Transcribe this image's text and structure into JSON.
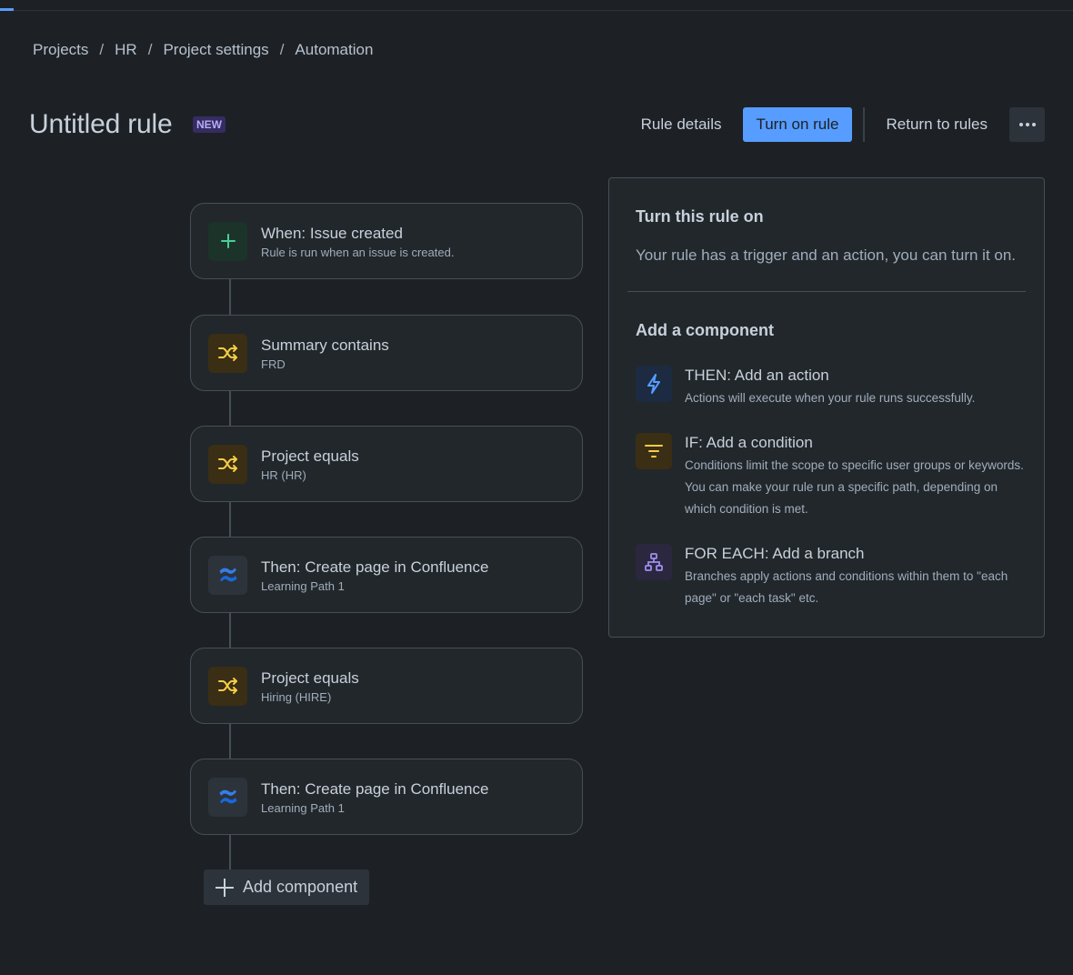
{
  "breadcrumb": {
    "items": [
      "Projects",
      "HR",
      "Project settings",
      "Automation"
    ],
    "separator": "/"
  },
  "header": {
    "title": "Untitled rule",
    "badge": "NEW",
    "rule_details": "Rule details",
    "turn_on": "Turn on rule",
    "return_to_rules": "Return to rules"
  },
  "flow": {
    "nodes": [
      {
        "title": "When: Issue created",
        "subtitle": "Rule is run when an issue is created.",
        "icon": "plus-icon"
      },
      {
        "title": "Summary contains",
        "subtitle": "FRD",
        "icon": "shuffle-icon"
      },
      {
        "title": "Project equals",
        "subtitle": "HR (HR)",
        "icon": "shuffle-icon"
      },
      {
        "title": "Then: Create page in Confluence",
        "subtitle": "Learning Path 1",
        "icon": "confluence-icon"
      },
      {
        "title": "Project equals",
        "subtitle": "Hiring (HIRE)",
        "icon": "shuffle-icon"
      },
      {
        "title": "Then: Create page in Confluence",
        "subtitle": "Learning Path 1",
        "icon": "confluence-icon"
      }
    ],
    "add_component": "Add component"
  },
  "panel": {
    "heading": "Turn this rule on",
    "text": "Your rule has a trigger and an action, you can turn it on.",
    "add_heading": "Add a component",
    "components": [
      {
        "title": "THEN: Add an action",
        "desc": "Actions will execute when your rule runs successfully.",
        "icon": "lightning-icon"
      },
      {
        "title": "IF: Add a condition",
        "desc": "Conditions limit the scope to specific user groups or keywords. You can make your rule run a specific path, depending on which condition is met.",
        "icon": "filter-icon"
      },
      {
        "title": "FOR EACH: Add a branch",
        "desc": "Branches apply actions and conditions within them to \"each page\" or \"each task\" etc.",
        "icon": "branch-icon"
      }
    ]
  },
  "colors": {
    "background": "#1d2125",
    "primary": "#579dff",
    "trigger_green": "#4bce97",
    "condition_yellow": "#f5cd47",
    "confluence_blue": "#1868db",
    "branch_purple": "#9f8fef"
  }
}
